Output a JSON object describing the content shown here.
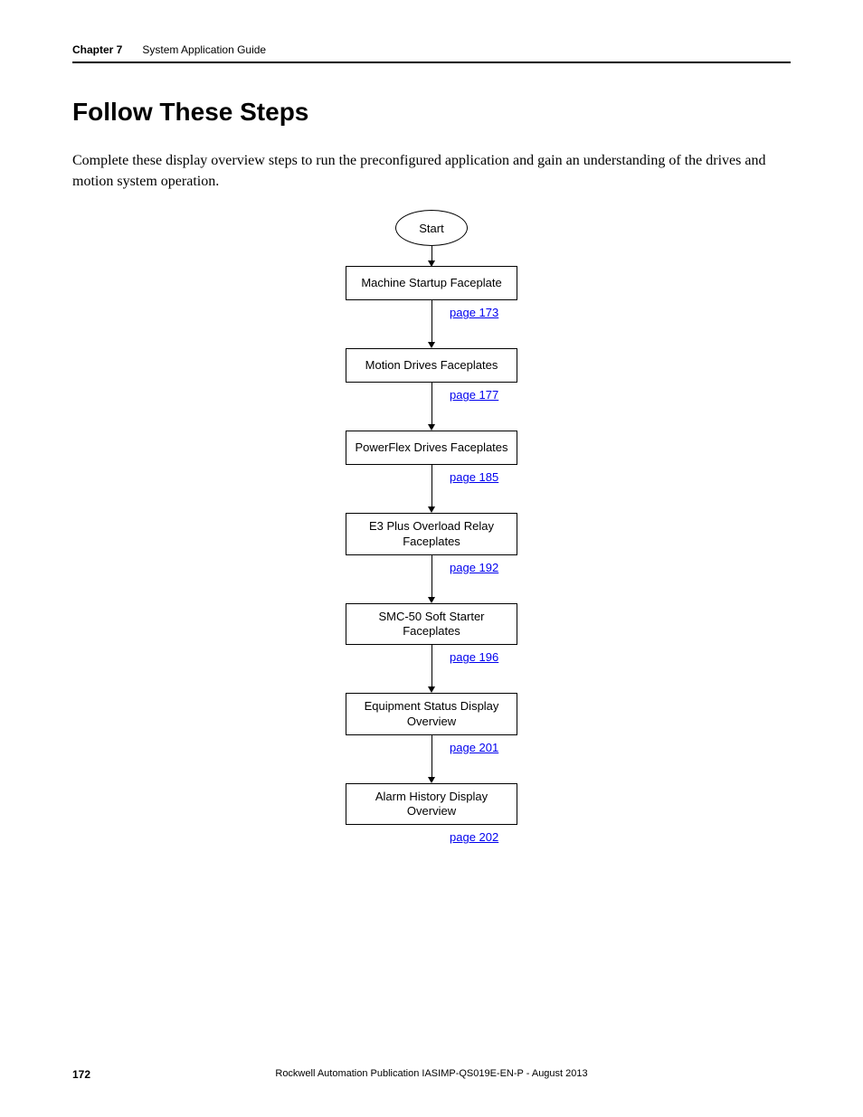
{
  "running_head": {
    "chapter": "Chapter 7",
    "section": "System Application Guide"
  },
  "title": "Follow These Steps",
  "body": "Complete these display overview steps to run the preconfigured application and gain an understanding of the drives and motion system operation.",
  "flow": {
    "start": "Start",
    "steps": [
      {
        "label": "Machine Startup Faceplate",
        "page": "page 173"
      },
      {
        "label": "Motion Drives Faceplates",
        "page": "page 177"
      },
      {
        "label": "PowerFlex Drives Faceplates",
        "page": "page 185"
      },
      {
        "label": "E3 Plus Overload Relay Faceplates",
        "page": "page 192"
      },
      {
        "label": "SMC-50 Soft Starter Faceplates",
        "page": "page 196"
      },
      {
        "label": "Equipment Status Display Overview",
        "page": "page 201"
      },
      {
        "label": "Alarm History Display Overview",
        "page": "page 202"
      }
    ]
  },
  "footer": {
    "page_number": "172",
    "publication": "Rockwell Automation Publication IASIMP-QS019E-EN-P - August 2013"
  }
}
